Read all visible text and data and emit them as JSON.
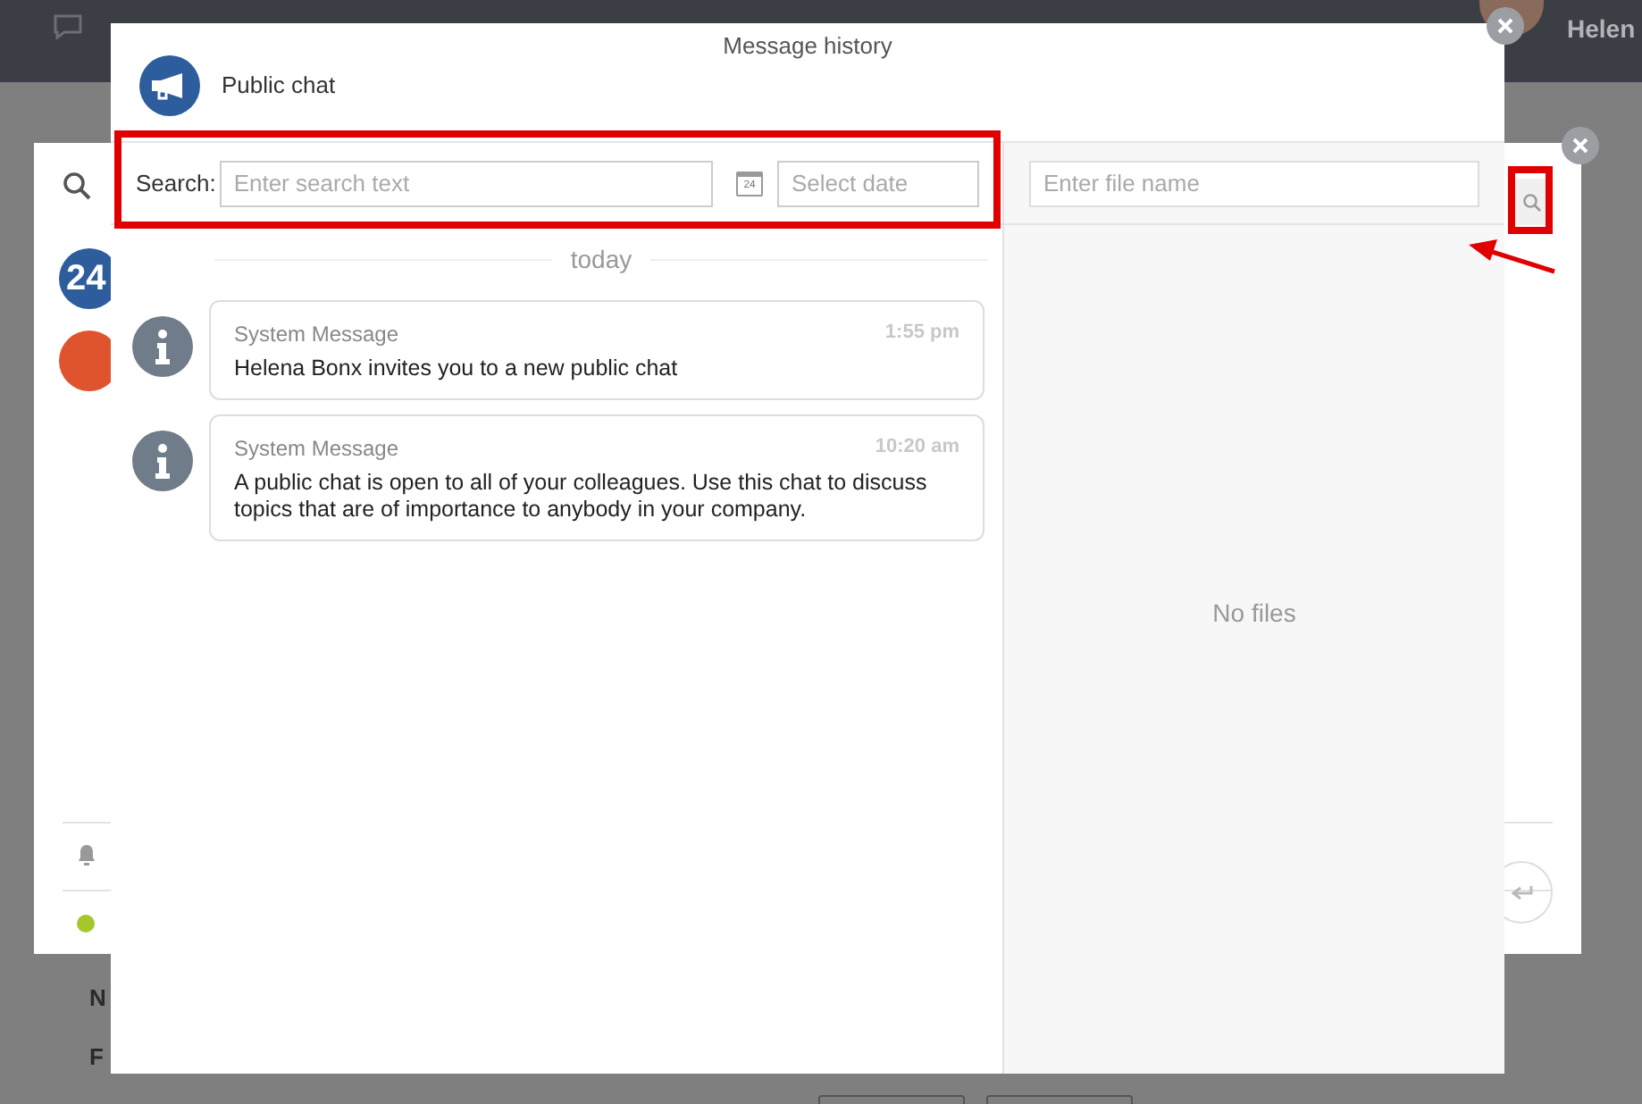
{
  "background": {
    "user_name": "Helen",
    "field_labels": [
      "N",
      "F"
    ],
    "status_online": true
  },
  "window": {
    "title": "Message history"
  },
  "chat": {
    "name": "Public chat"
  },
  "search": {
    "label": "Search:",
    "placeholder": "Enter search text",
    "date_placeholder": "Select date",
    "calendar_day": "24"
  },
  "day_separator": "today",
  "messages": [
    {
      "author": "System Message",
      "time": "1:55 pm",
      "text": "Helena Bonx invites you to a new public chat"
    },
    {
      "author": "System Message",
      "time": "10:20 am",
      "text": "A public chat is open to all of your colleagues. Use this chat to discuss topics that are of importance to anybody in your company."
    }
  ],
  "files": {
    "placeholder": "Enter file name",
    "empty_text": "No files"
  },
  "sidebar_badge": "24"
}
